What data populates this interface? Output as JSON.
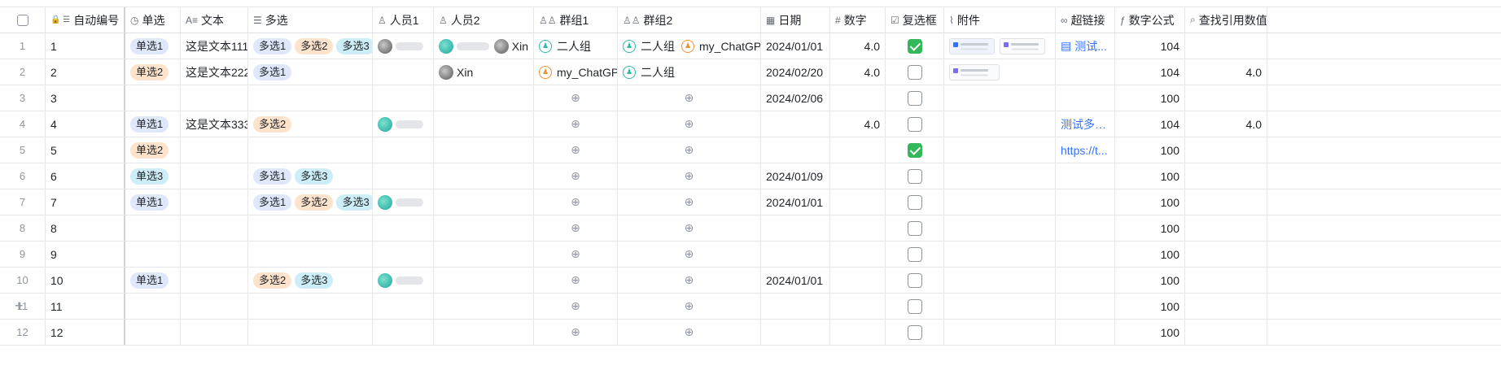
{
  "columns": [
    {
      "key": "select",
      "label": "",
      "icon": "checkbox-icon"
    },
    {
      "key": "autonum",
      "label": "自动编号",
      "icon": "lock-icon"
    },
    {
      "key": "single",
      "label": "单选",
      "icon": "single-select-icon"
    },
    {
      "key": "text",
      "label": "文本",
      "icon": "text-icon"
    },
    {
      "key": "multi",
      "label": "多选",
      "icon": "multi-select-icon"
    },
    {
      "key": "person1",
      "label": "人员1",
      "icon": "person-icon"
    },
    {
      "key": "person2",
      "label": "人员2",
      "icon": "person-icon"
    },
    {
      "key": "group1",
      "label": "群组1",
      "icon": "group-icon"
    },
    {
      "key": "group2",
      "label": "群组2",
      "icon": "group-icon"
    },
    {
      "key": "date",
      "label": "日期",
      "icon": "calendar-icon"
    },
    {
      "key": "number",
      "label": "数字",
      "icon": "hash-icon"
    },
    {
      "key": "checkbox",
      "label": "复选框",
      "icon": "checkbox-icon"
    },
    {
      "key": "attachment",
      "label": "附件",
      "icon": "paperclip-icon"
    },
    {
      "key": "hyperlink",
      "label": "超链接",
      "icon": "link-icon"
    },
    {
      "key": "formula",
      "label": "数字公式",
      "icon": "formula-icon"
    },
    {
      "key": "lookup",
      "label": "查找引用数值",
      "icon": "lookup-icon"
    }
  ],
  "rows": [
    {
      "n": "1",
      "auto": "1",
      "single": [
        {
          "t": "单选1",
          "c": "blue"
        }
      ],
      "text": "这是文本111",
      "multi": [
        {
          "t": "多选1",
          "c": "blue"
        },
        {
          "t": "多选2",
          "c": "orange"
        },
        {
          "t": "多选3",
          "c": "cyan"
        }
      ],
      "p1": [
        {
          "av": "gray"
        }
      ],
      "p2": [
        {
          "av": "teal"
        },
        {
          "av": "gray",
          "name": "Xin"
        }
      ],
      "g1": [
        {
          "name": "二人组",
          "c": "teal"
        }
      ],
      "g2": [
        {
          "name": "二人组",
          "c": "teal"
        },
        {
          "name": "my_ChatGPT",
          "c": "orange"
        }
      ],
      "date": "2024/01/01",
      "num": "4.0",
      "chk": true,
      "att": 2,
      "link": "测试...",
      "linkdoc": true,
      "formula": "104",
      "lookup": ""
    },
    {
      "n": "2",
      "auto": "2",
      "single": [
        {
          "t": "单选2",
          "c": "orange"
        }
      ],
      "text": "这是文本222",
      "multi": [
        {
          "t": "多选1",
          "c": "blue"
        }
      ],
      "p1": [],
      "p2": [
        {
          "av": "gray",
          "name": "Xin"
        }
      ],
      "g1": [
        {
          "name": "my_ChatGPT",
          "c": "orange"
        }
      ],
      "g2": [
        {
          "name": "二人组",
          "c": "teal"
        }
      ],
      "date": "2024/02/20",
      "num": "4.0",
      "chk": false,
      "att": 1,
      "link": "",
      "formula": "104",
      "lookup": "4.0"
    },
    {
      "n": "3",
      "auto": "3",
      "single": [],
      "text": "",
      "multi": [],
      "p1": [],
      "p2": [],
      "g1": [],
      "g2": [],
      "date": "2024/02/06",
      "num": "",
      "chk": false,
      "att": 0,
      "link": "",
      "formula": "100",
      "lookup": ""
    },
    {
      "n": "4",
      "auto": "4",
      "single": [
        {
          "t": "单选1",
          "c": "blue"
        }
      ],
      "text": "这是文本333",
      "multi": [
        {
          "t": "多选2",
          "c": "orange"
        }
      ],
      "p1": [
        {
          "av": "teal"
        }
      ],
      "p2": [],
      "g1": [],
      "g2": [],
      "date": "",
      "num": "4.0",
      "chk": false,
      "att": 0,
      "link": "测试多维...",
      "formula": "104",
      "lookup": "4.0"
    },
    {
      "n": "5",
      "auto": "5",
      "single": [
        {
          "t": "单选2",
          "c": "orange"
        }
      ],
      "text": "",
      "multi": [],
      "p1": [],
      "p2": [],
      "g1": [],
      "g2": [],
      "date": "",
      "num": "",
      "chk": true,
      "att": 0,
      "link": "https://t...",
      "formula": "100",
      "lookup": ""
    },
    {
      "n": "6",
      "auto": "6",
      "single": [
        {
          "t": "单选3",
          "c": "cyan"
        }
      ],
      "text": "",
      "multi": [
        {
          "t": "多选1",
          "c": "blue"
        },
        {
          "t": "多选3",
          "c": "cyan"
        }
      ],
      "p1": [],
      "p2": [],
      "g1": [],
      "g2": [],
      "date": "2024/01/09",
      "num": "",
      "chk": false,
      "att": 0,
      "link": "",
      "formula": "100",
      "lookup": ""
    },
    {
      "n": "7",
      "auto": "7",
      "single": [
        {
          "t": "单选1",
          "c": "blue"
        }
      ],
      "text": "",
      "multi": [
        {
          "t": "多选1",
          "c": "blue"
        },
        {
          "t": "多选2",
          "c": "orange"
        },
        {
          "t": "多选3",
          "c": "cyan"
        }
      ],
      "p1": [
        {
          "av": "teal"
        }
      ],
      "p2": [],
      "g1": [],
      "g2": [],
      "date": "2024/01/01",
      "num": "",
      "chk": false,
      "att": 0,
      "link": "",
      "formula": "100",
      "lookup": ""
    },
    {
      "n": "8",
      "auto": "8",
      "single": [],
      "text": "",
      "multi": [],
      "p1": [],
      "p2": [],
      "g1": [],
      "g2": [],
      "date": "",
      "num": "",
      "chk": false,
      "att": 0,
      "link": "",
      "formula": "100",
      "lookup": ""
    },
    {
      "n": "9",
      "auto": "9",
      "single": [],
      "text": "",
      "multi": [],
      "p1": [],
      "p2": [],
      "g1": [],
      "g2": [],
      "date": "",
      "num": "",
      "chk": false,
      "att": 0,
      "link": "",
      "formula": "100",
      "lookup": ""
    },
    {
      "n": "10",
      "auto": "10",
      "single": [
        {
          "t": "单选1",
          "c": "blue"
        }
      ],
      "text": "",
      "multi": [
        {
          "t": "多选2",
          "c": "orange"
        },
        {
          "t": "多选3",
          "c": "cyan"
        }
      ],
      "p1": [
        {
          "av": "teal"
        }
      ],
      "p2": [],
      "g1": [],
      "g2": [],
      "date": "2024/01/01",
      "num": "",
      "chk": false,
      "att": 0,
      "link": "",
      "formula": "100",
      "lookup": ""
    },
    {
      "n": "11",
      "auto": "11",
      "single": [],
      "text": "",
      "multi": [],
      "p1": [],
      "p2": [],
      "g1": [],
      "g2": [],
      "date": "",
      "num": "",
      "chk": false,
      "att": 0,
      "link": "",
      "formula": "100",
      "lookup": ""
    },
    {
      "n": "12",
      "auto": "12",
      "single": [],
      "text": "",
      "multi": [],
      "p1": [],
      "p2": [],
      "g1": [],
      "g2": [],
      "date": "",
      "num": "",
      "chk": false,
      "att": 0,
      "link": "",
      "formula": "100",
      "lookup": ""
    }
  ],
  "add_row_label": "+",
  "colors": {
    "accent": "#3370ff",
    "check": "#34b75b",
    "grid": "#e4e6ea"
  }
}
